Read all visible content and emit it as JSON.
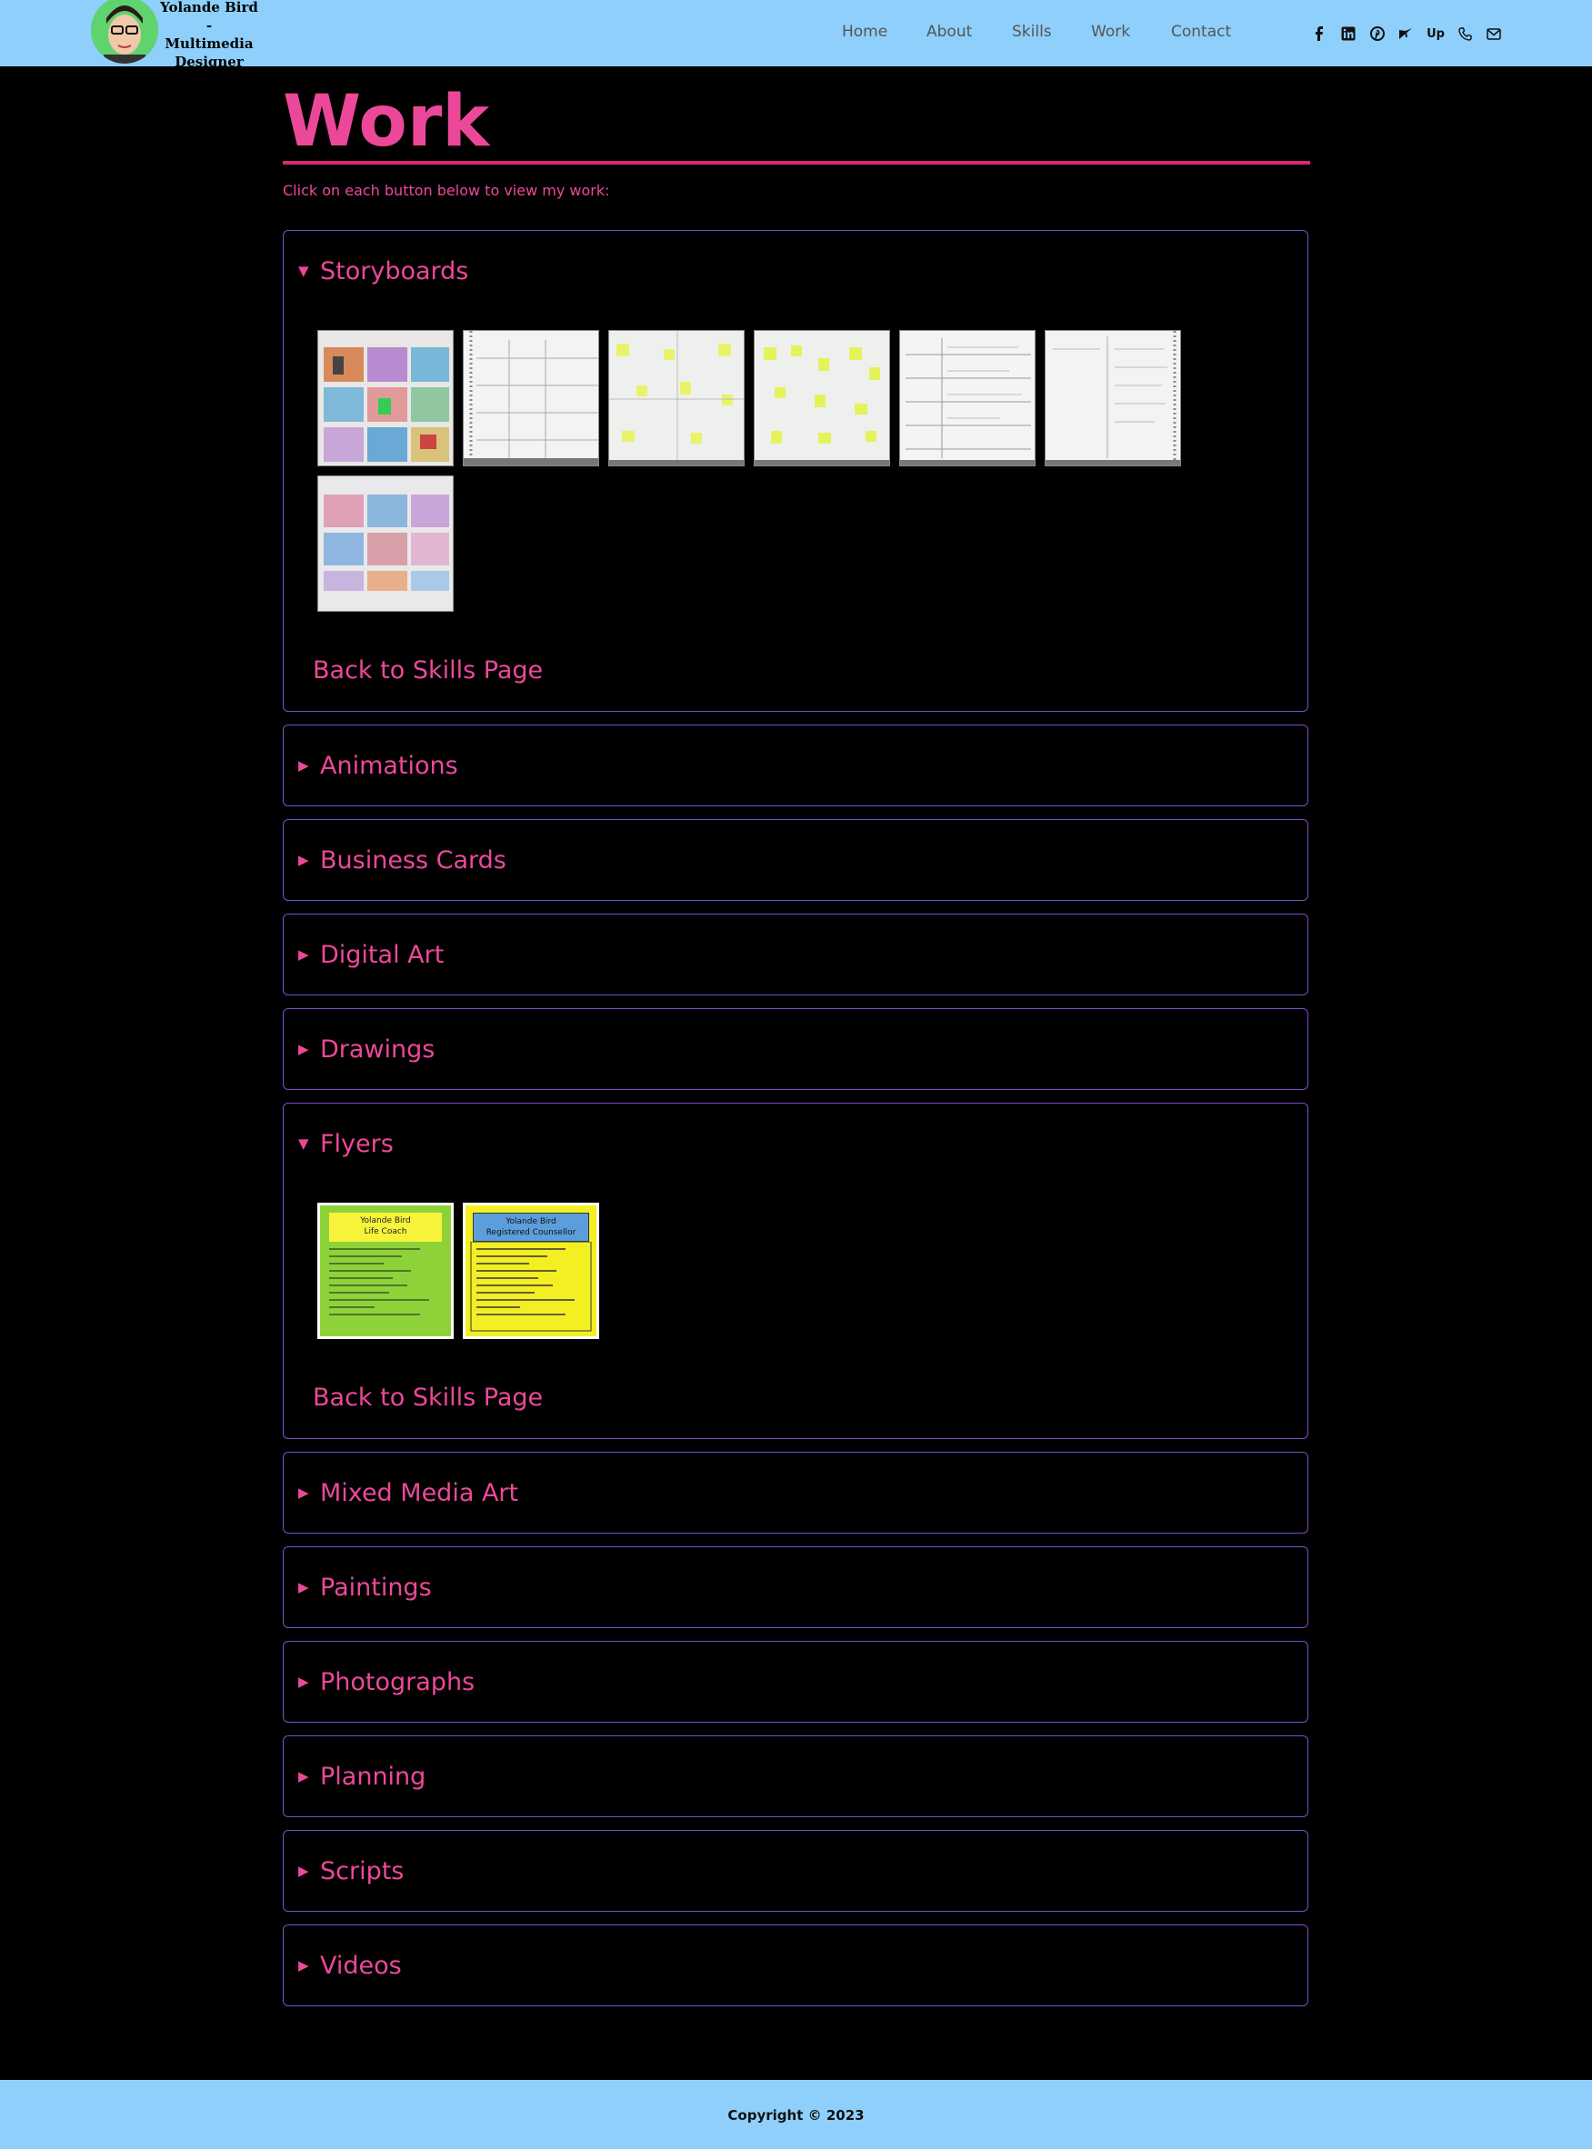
{
  "header": {
    "logo_line1": "Yolande Bird",
    "logo_line2": "-",
    "logo_line3": "Multimedia",
    "logo_line4": "Designer",
    "nav": [
      "Home",
      "About",
      "Skills",
      "Work",
      "Contact"
    ],
    "social_icons": [
      "facebook-icon",
      "linkedin-icon",
      "pinterest-icon",
      "fiverr-icon",
      "upwork-icon",
      "phone-icon",
      "mail-icon"
    ],
    "upwork_text": "Up",
    "bg_color": "#8ecffb"
  },
  "main": {
    "title": "Work",
    "intro": "Click on each button below to view my work:",
    "accent_color": "#ec4899",
    "sections": [
      {
        "label": "Storyboards",
        "expanded": true,
        "back_label": "Back to Skills Page"
      },
      {
        "label": "Animations",
        "expanded": false
      },
      {
        "label": "Business Cards",
        "expanded": false
      },
      {
        "label": "Digital Art",
        "expanded": false
      },
      {
        "label": "Drawings",
        "expanded": false
      },
      {
        "label": "Flyers",
        "expanded": true,
        "back_label": "Back to Skills Page"
      },
      {
        "label": "Mixed Media Art",
        "expanded": false
      },
      {
        "label": "Paintings",
        "expanded": false
      },
      {
        "label": "Photographs",
        "expanded": false
      },
      {
        "label": "Planning",
        "expanded": false
      },
      {
        "label": "Scripts",
        "expanded": false
      },
      {
        "label": "Videos",
        "expanded": false
      }
    ],
    "arrow_open": "▼",
    "arrow_closed": "▶",
    "flyers": [
      {
        "name": "Yolande Bird",
        "role": "Life Coach"
      },
      {
        "name": "Yolande Bird",
        "role": "Registered Counsellor"
      }
    ]
  },
  "footer": {
    "copyright": "Copyright © 2023"
  }
}
